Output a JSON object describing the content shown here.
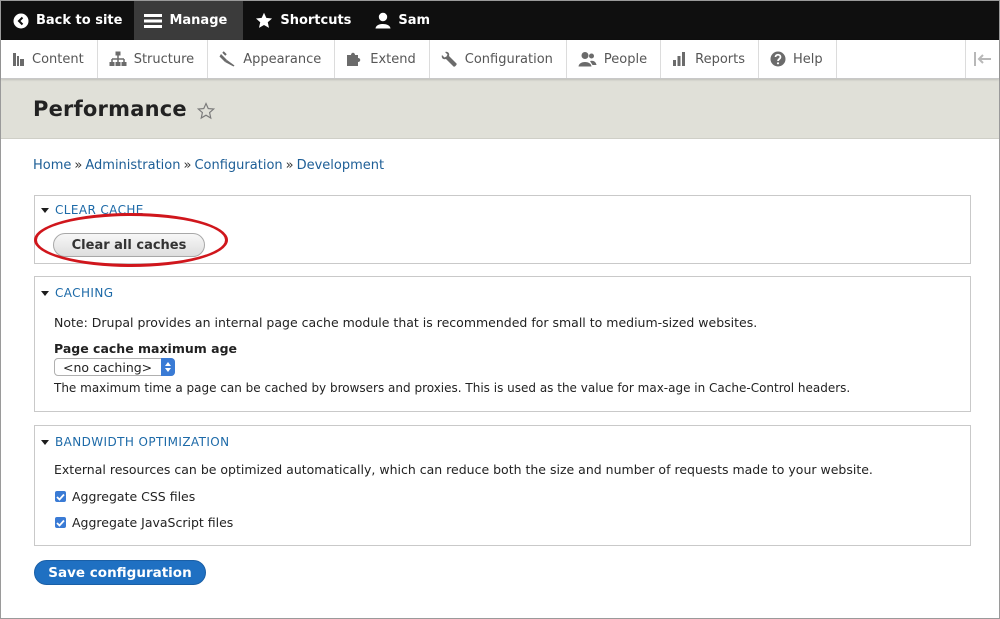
{
  "toolbar": {
    "back_label": "Back to site",
    "manage_label": "Manage",
    "shortcuts_label": "Shortcuts",
    "user_label": "Sam"
  },
  "tray": {
    "items": [
      {
        "label": "Content",
        "icon": "content-icon"
      },
      {
        "label": "Structure",
        "icon": "structure-icon"
      },
      {
        "label": "Appearance",
        "icon": "appearance-icon"
      },
      {
        "label": "Extend",
        "icon": "extend-icon"
      },
      {
        "label": "Configuration",
        "icon": "wrench-icon"
      },
      {
        "label": "People",
        "icon": "people-icon"
      },
      {
        "label": "Reports",
        "icon": "reports-icon"
      },
      {
        "label": "Help",
        "icon": "help-icon"
      }
    ]
  },
  "page": {
    "title": "Performance"
  },
  "breadcrumb": [
    "Home",
    "Administration",
    "Configuration",
    "Development"
  ],
  "clear_cache": {
    "legend": "CLEAR CACHE",
    "button_label": "Clear all caches"
  },
  "caching": {
    "legend": "CACHING",
    "note": "Note: Drupal provides an internal page cache module that is recommended for small to medium-sized websites.",
    "field_label": "Page cache maximum age",
    "select_value": "<no caching>",
    "description": "The maximum time a page can be cached by browsers and proxies. This is used as the value for max-age in Cache-Control headers."
  },
  "bandwidth": {
    "legend": "BANDWIDTH OPTIMIZATION",
    "description": "External resources can be optimized automatically, which can reduce both the size and number of requests made to your website.",
    "css_label": "Aggregate CSS files",
    "css_checked": true,
    "js_label": "Aggregate JavaScript files",
    "js_checked": true
  },
  "save_label": "Save configuration",
  "colors": {
    "link": "#1d5e96",
    "primary_button": "#1f70c2",
    "highlight_ellipse": "#d0161c"
  }
}
